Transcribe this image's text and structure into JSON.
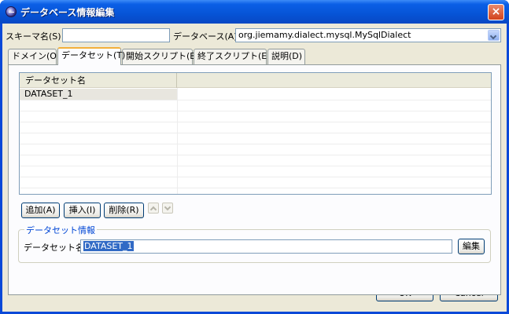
{
  "window": {
    "title": "データベース情報編集",
    "close_label": "×"
  },
  "schema": {
    "label": "スキーマ名(S)",
    "value": ""
  },
  "database": {
    "label": "データベース(A)",
    "value": "org.jiemamy.dialect.mysql.MySqlDialect"
  },
  "tabs": [
    {
      "label": "ドメイン(O)"
    },
    {
      "label": "データセット(T)"
    },
    {
      "label": "開始スクリプト(B)"
    },
    {
      "label": "終了スクリプト(E)"
    },
    {
      "label": "説明(D)"
    }
  ],
  "dataset_table": {
    "columns": [
      "データセット名",
      ""
    ],
    "rows": [
      [
        "DATASET_1",
        ""
      ]
    ]
  },
  "table_buttons": {
    "add": "追加(A)",
    "insert": "挿入(I)",
    "delete": "削除(R)"
  },
  "dataset_info": {
    "group_title": "データセット情報",
    "name_label": "データセット名",
    "name_value": "DATASET_1",
    "edit_button": "編集"
  },
  "dialog": {
    "ok": "OK",
    "cancel": "Cancel"
  },
  "colors": {
    "titlebar": "#0654d6",
    "client": "#ece9d8",
    "selection": "#316ac5",
    "group_title": "#0046d5",
    "active_tab_highlight": "#f3b03b"
  }
}
